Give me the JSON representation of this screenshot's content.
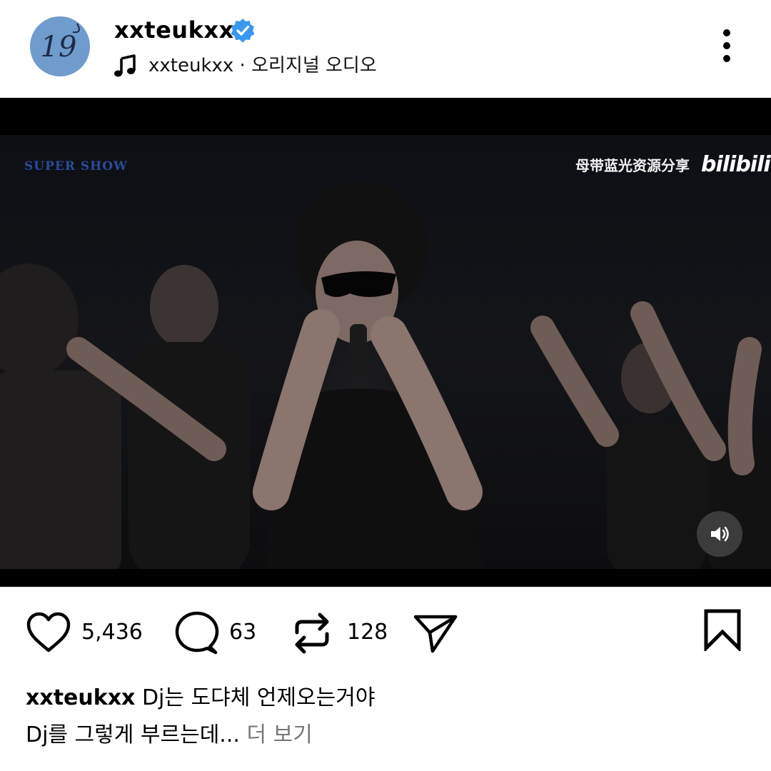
{
  "post": {
    "username": "xxteukxx",
    "verified": true,
    "audio_label": "xxteukxx · 오리지널 오디오",
    "avatar_text": "19",
    "avatar_color": "#6f9ccc",
    "accent_color": "#3897f0"
  },
  "video": {
    "watermark_left": "SUPER SHOW",
    "watermark_right": "母带蓝光资源分享",
    "watermark_brand": "bilibili",
    "sound_state": "on"
  },
  "actions": {
    "likes": "5,436",
    "comments": "63",
    "reposts": "128"
  },
  "caption": {
    "username": "xxteukxx",
    "line1": "Dj는 도댜체 언제오는거야",
    "line2": "Dj를 그렇게 부르는데...",
    "more_label": "더 보기"
  },
  "icons": [
    "verified-badge-icon",
    "music-note-icon",
    "more-vertical-icon",
    "volume-icon",
    "heart-icon",
    "comment-icon",
    "repost-icon",
    "share-icon",
    "bookmark-icon"
  ]
}
